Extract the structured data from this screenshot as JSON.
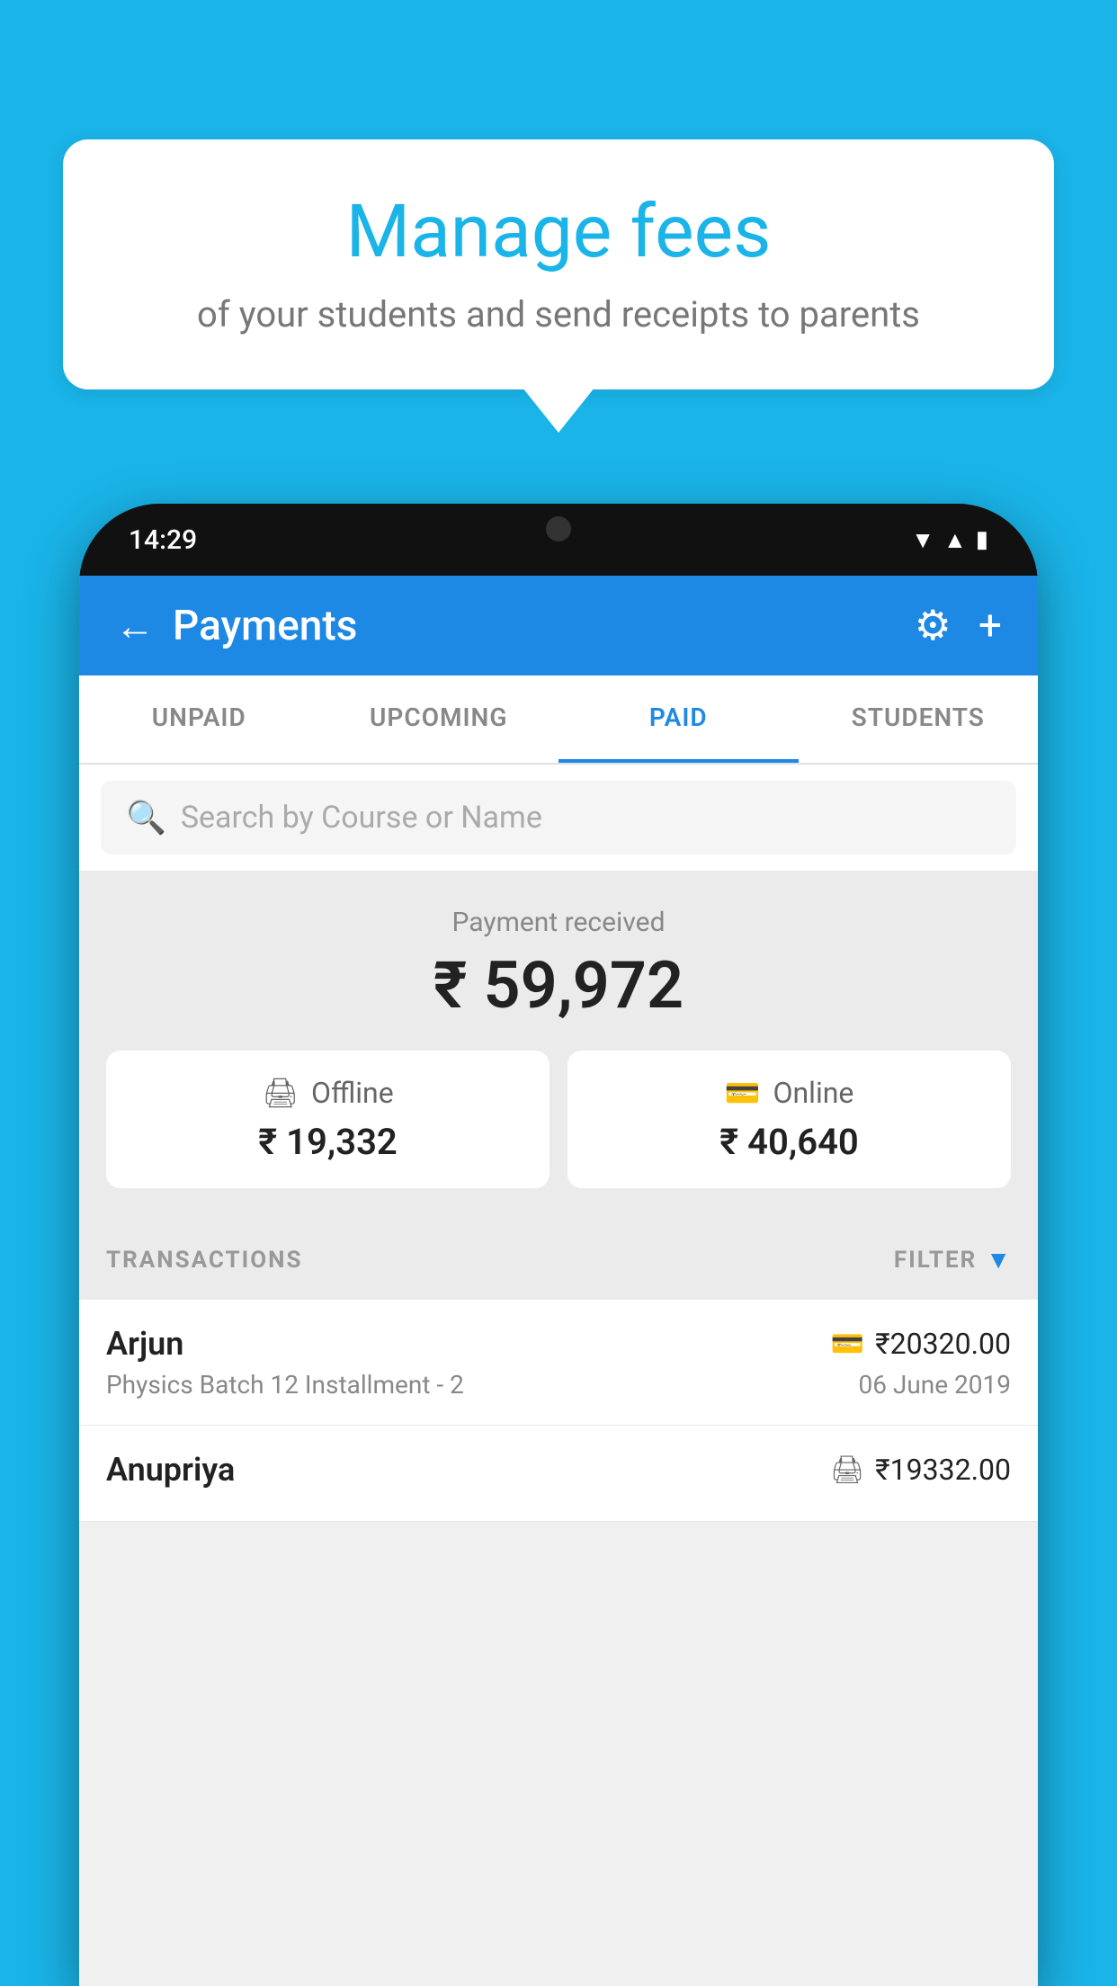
{
  "background_color": "#1ab4e8",
  "speech_bubble": {
    "title": "Manage fees",
    "subtitle": "of your students and send receipts to parents"
  },
  "phone": {
    "status_bar": {
      "time": "14:29"
    },
    "header": {
      "title": "Payments",
      "back_label": "←",
      "gear_label": "⚙",
      "plus_label": "+"
    },
    "tabs": [
      {
        "label": "UNPAID",
        "active": false
      },
      {
        "label": "UPCOMING",
        "active": false
      },
      {
        "label": "PAID",
        "active": true
      },
      {
        "label": "STUDENTS",
        "active": false
      }
    ],
    "search": {
      "placeholder": "Search by Course or Name"
    },
    "payment_summary": {
      "label": "Payment received",
      "amount": "₹ 59,972",
      "offline": {
        "icon": "🧾",
        "type": "Offline",
        "amount": "₹ 19,332"
      },
      "online": {
        "icon": "💳",
        "type": "Online",
        "amount": "₹ 40,640"
      }
    },
    "transactions": {
      "header_label": "TRANSACTIONS",
      "filter_label": "FILTER",
      "items": [
        {
          "name": "Arjun",
          "icon": "💳",
          "amount": "₹20320.00",
          "course": "Physics Batch 12 Installment - 2",
          "date": "06 June 2019"
        },
        {
          "name": "Anupriya",
          "icon": "🧾",
          "amount": "₹19332.00",
          "course": "",
          "date": ""
        }
      ]
    }
  }
}
